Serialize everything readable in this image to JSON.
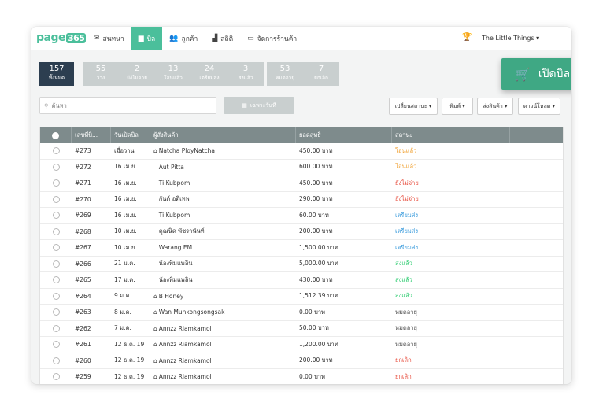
{
  "app": {
    "logo": "page",
    "logo_num": "365",
    "shop_name": "The Little Things ▾"
  },
  "nav": [
    {
      "icon": "chat-icon",
      "label": "สนทนา",
      "active": false
    },
    {
      "icon": "bill-icon",
      "label": "บิล",
      "active": true
    },
    {
      "icon": "customers-icon",
      "label": "ลูกค้า",
      "active": false
    },
    {
      "icon": "stats-icon",
      "label": "สถิติ",
      "active": false
    },
    {
      "icon": "store-icon",
      "label": "จัดการร้านค้า",
      "active": false
    }
  ],
  "status_tabs": {
    "all": {
      "count": "157",
      "label": "ทั้งหมด"
    },
    "group1": [
      {
        "count": "55",
        "label": "ว่าง"
      },
      {
        "count": "2",
        "label": "ยังไม่จ่าย"
      },
      {
        "count": "13",
        "label": "โอนแล้ว"
      },
      {
        "count": "24",
        "label": "เตรียมส่ง"
      },
      {
        "count": "3",
        "label": "ส่งแล้ว"
      }
    ],
    "group2": [
      {
        "count": "53",
        "label": "หมดอายุ"
      },
      {
        "count": "7",
        "label": "ยกเลิก"
      }
    ]
  },
  "new_bill_label": "เปิดบิล",
  "search": {
    "placeholder": "ค้นหา",
    "value": ""
  },
  "date_button": "เฉพาะวันที่",
  "filters": [
    {
      "label": "เปลี่ยนสถานะ ▾"
    },
    {
      "label": "พิมพ์ ▾"
    },
    {
      "label": "ส่งสินค้า ▾"
    },
    {
      "label": "ดาวน์โหลด ▾"
    }
  ],
  "table": {
    "headers": [
      "เลขที่บิ...",
      "วันเปิดบิล",
      "ผู้สั่งสินค้า",
      "ยอดสุทธิ",
      "สถานะ"
    ],
    "rows": [
      {
        "id": "#273",
        "date": "เมื่อวาน",
        "home": true,
        "customer": "Natcha PloyNatcha",
        "total": "450.00 บาท",
        "status": "โอนแล้ว",
        "status_class": "st-orange"
      },
      {
        "id": "#272",
        "date": "16 เม.ย.",
        "home": false,
        "customer": "Aut Pitta",
        "total": "600.00 บาท",
        "status": "โอนแล้ว",
        "status_class": "st-orange"
      },
      {
        "id": "#271",
        "date": "16 เม.ย.",
        "home": false,
        "customer": "Ti Kubpom",
        "total": "450.00 บาท",
        "status": "ยังไม่จ่าย",
        "status_class": "st-red"
      },
      {
        "id": "#270",
        "date": "16 เม.ย.",
        "home": false,
        "customer": "กันต์ อดิเทพ",
        "total": "290.00 บาท",
        "status": "ยังไม่จ่าย",
        "status_class": "st-red"
      },
      {
        "id": "#269",
        "date": "16 เม.ย.",
        "home": false,
        "customer": "Ti Kubpom",
        "total": "60.00 บาท",
        "status": "เตรียมส่ง",
        "status_class": "st-blue"
      },
      {
        "id": "#268",
        "date": "10 เม.ย.",
        "home": false,
        "customer": "คุณนิด พัชรานันท์",
        "total": "200.00 บาท",
        "status": "เตรียมส่ง",
        "status_class": "st-blue"
      },
      {
        "id": "#267",
        "date": "10 เม.ย.",
        "home": false,
        "customer": "Warang EM",
        "total": "1,500.00 บาท",
        "status": "เตรียมส่ง",
        "status_class": "st-blue"
      },
      {
        "id": "#266",
        "date": "21 ม.ค.",
        "home": false,
        "customer": "น้องพิมแพลิน",
        "total": "5,000.00 บาท",
        "status": "ส่งแล้ว",
        "status_class": "st-green"
      },
      {
        "id": "#265",
        "date": "17 ม.ค.",
        "home": false,
        "customer": "น้องพิมแพลิน",
        "total": "430.00 บาท",
        "status": "ส่งแล้ว",
        "status_class": "st-green"
      },
      {
        "id": "#264",
        "date": "9 ม.ค.",
        "home": true,
        "customer": "B Honey",
        "total": "1,512.39 บาท",
        "status": "ส่งแล้ว",
        "status_class": "st-green"
      },
      {
        "id": "#263",
        "date": "8 ม.ค.",
        "home": true,
        "customer": "Wan Munkongsongsak",
        "total": "0.00 บาท",
        "status": "หมดอายุ",
        "status_class": "st-gray"
      },
      {
        "id": "#262",
        "date": "7 ม.ค.",
        "home": true,
        "customer": "Annzz Riamkamol",
        "total": "50.00 บาท",
        "status": "หมดอายุ",
        "status_class": "st-gray"
      },
      {
        "id": "#261",
        "date": "12 ธ.ค. 19",
        "home": true,
        "customer": "Annzz Riamkamol",
        "total": "1,200.00 บาท",
        "status": "หมดอายุ",
        "status_class": "st-gray"
      },
      {
        "id": "#260",
        "date": "12 ธ.ค. 19",
        "home": true,
        "customer": "Annzz Riamkamol",
        "total": "200.00 บาท",
        "status": "ยกเลิก",
        "status_class": "st-red"
      },
      {
        "id": "#259",
        "date": "12 ธ.ค. 19",
        "home": true,
        "customer": "Annzz Riamkamol",
        "total": "0.00 บาท",
        "status": "ยกเลิก",
        "status_class": "st-red"
      }
    ]
  }
}
